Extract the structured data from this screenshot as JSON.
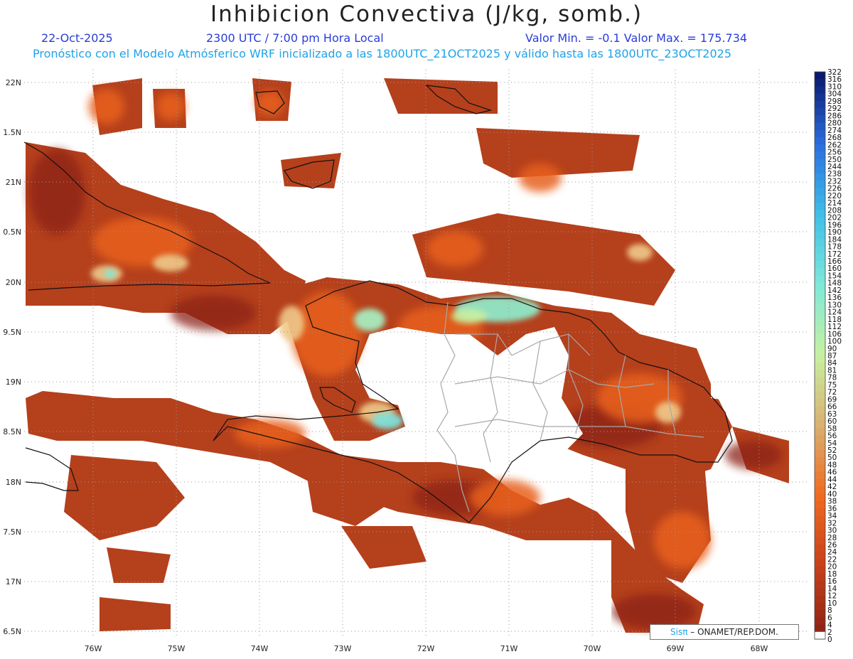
{
  "header": {
    "title": "Inhibicion Convectiva (J/kg, somb.)",
    "date": "22-Oct-2025",
    "time": "2300 UTC / 7:00 pm Hora Local",
    "minmax": "Valor Min. = -0.1  Valor Max. = 175.734",
    "subtitle": "Pronóstico con el Modelo Atmósferico WRF inicializado a las 1800UTC_21OCT2025 y válido hasta las  1800UTC_23OCT2025"
  },
  "axes": {
    "lat_labels": [
      "22N",
      "1.5N",
      "21N",
      "0.5N",
      "20N",
      "9.5N",
      "19N",
      "8.5N",
      "18N",
      "7.5N",
      "17N",
      "6.5N"
    ],
    "lon_labels": [
      "76W",
      "75W",
      "74W",
      "73W",
      "72W",
      "71W",
      "70W",
      "69W",
      "68W"
    ]
  },
  "colorbar": {
    "labels": [
      "322",
      "316",
      "310",
      "304",
      "298",
      "292",
      "286",
      "280",
      "274",
      "268",
      "262",
      "256",
      "250",
      "244",
      "238",
      "232",
      "226",
      "220",
      "214",
      "208",
      "202",
      "196",
      "190",
      "184",
      "178",
      "172",
      "166",
      "160",
      "154",
      "148",
      "142",
      "136",
      "130",
      "124",
      "118",
      "112",
      "106",
      "100",
      "90",
      "87",
      "84",
      "81",
      "78",
      "75",
      "72",
      "69",
      "66",
      "63",
      "60",
      "58",
      "56",
      "54",
      "52",
      "50",
      "48",
      "46",
      "44",
      "42",
      "40",
      "38",
      "36",
      "34",
      "32",
      "30",
      "28",
      "26",
      "24",
      "22",
      "20",
      "18",
      "16",
      "14",
      "12",
      "10",
      "8",
      "6",
      "4",
      "2",
      "0"
    ],
    "colors": {
      "top": "#0a1a6e",
      "upper_blue": "#2a6fe0",
      "light_blue": "#3fc0e8",
      "cyan": "#7fe8d8",
      "pale_green": "#c8f0a0",
      "tan": "#d9b070",
      "orange": "#f06a20",
      "red_orange": "#c8401a",
      "dark_red": "#8b2214"
    }
  },
  "credit": {
    "brand": "Sisπ",
    "text": "– ONAMET/REP.DOM."
  }
}
